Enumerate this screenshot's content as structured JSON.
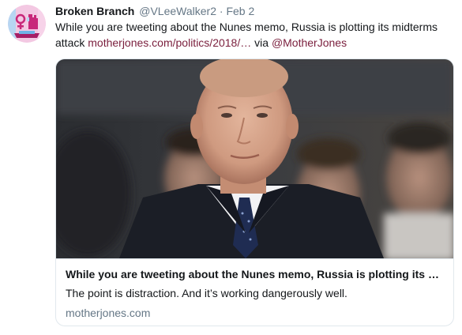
{
  "author": {
    "display_name": "Broken Branch",
    "handle": "@VLeeWalker2",
    "separator": "·",
    "timestamp": "Feb 2",
    "avatar_icon": "feminist-fist-logo-icon"
  },
  "tweet": {
    "text_before": "While you are tweeting about the Nunes memo, Russia is plotting its midterms attack ",
    "link_text": "motherjones.com/politics/2018/…",
    "via_text": " via ",
    "mention_text": "@MotherJones"
  },
  "card": {
    "image_icon": "article-photo",
    "title": "While you are tweeting about the Nunes memo, Russia is plotting its …",
    "description": "The point is distraction. And it’s working dangerously well.",
    "domain": "motherjones.com"
  },
  "colors": {
    "link": "#7a1e3c",
    "secondary_text": "#657786",
    "border": "#e1e8ed"
  }
}
